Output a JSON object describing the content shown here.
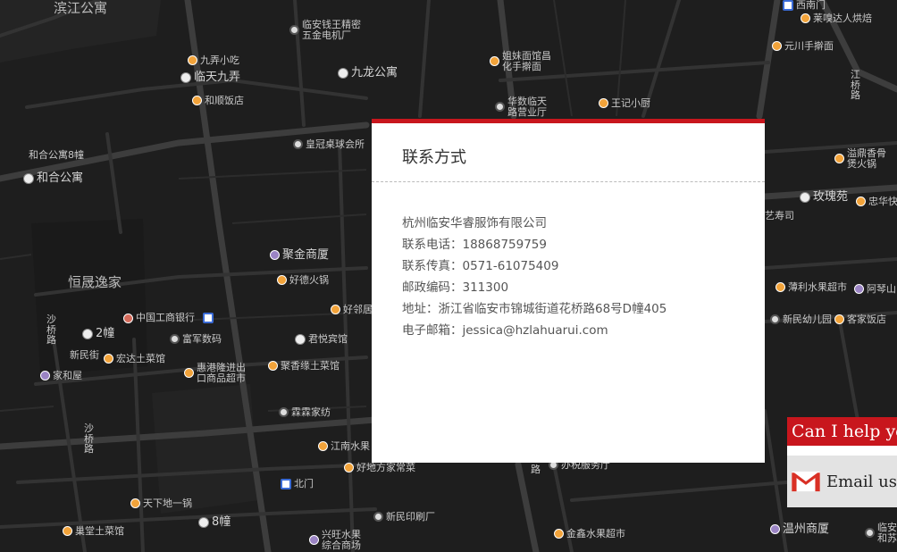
{
  "map": {
    "pois": [
      {
        "label": "滨江公寓",
        "kind": "district"
      },
      {
        "label": "临安钱王精密",
        "kind": "dot"
      },
      {
        "label": "五金电机厂",
        "kind": "none"
      },
      {
        "label": "九弄小吃",
        "kind": "food"
      },
      {
        "label": "临天九弄",
        "kind": "bld"
      },
      {
        "label": "和顺饭店",
        "kind": "food"
      },
      {
        "label": "九龙公寓",
        "kind": "bld"
      },
      {
        "label": "姐妹面馆昌",
        "kind": "food"
      },
      {
        "label": "化手擀面",
        "kind": "none"
      },
      {
        "label": "华数临天",
        "kind": "dot"
      },
      {
        "label": "路营业厅",
        "kind": "none"
      },
      {
        "label": "王记小厨",
        "kind": "food"
      },
      {
        "label": "莱嗅达人烘焙",
        "kind": "food"
      },
      {
        "label": "元川手擀面",
        "kind": "food"
      },
      {
        "label": "江",
        "kind": "none"
      },
      {
        "label": "桥",
        "kind": "none"
      },
      {
        "label": "路",
        "kind": "none"
      },
      {
        "label": "和合公寓8幢",
        "kind": "none"
      },
      {
        "label": "和合公寓",
        "kind": "bld"
      },
      {
        "label": "皇冠桌球会所",
        "kind": "dot"
      },
      {
        "label": "溢鼎香骨",
        "kind": "food"
      },
      {
        "label": "煲火锅",
        "kind": "none"
      },
      {
        "label": "玫瑰苑",
        "kind": "bld"
      },
      {
        "label": "忠华快",
        "kind": "food"
      },
      {
        "label": "艺寿司",
        "kind": "none"
      },
      {
        "label": "恒晟逸家",
        "kind": "district"
      },
      {
        "label": "聚金商厦",
        "kind": "shop"
      },
      {
        "label": "好德火锅",
        "kind": "food"
      },
      {
        "label": "好邻居",
        "kind": "food"
      },
      {
        "label": "中国工商银行",
        "kind": "bank"
      },
      {
        "label": "2幢",
        "kind": "bld"
      },
      {
        "label": "富军数码",
        "kind": "dot"
      },
      {
        "label": "君悦宾馆",
        "kind": "bld"
      },
      {
        "label": "新民街",
        "kind": "none"
      },
      {
        "label": "宏达土菜馆",
        "kind": "food"
      },
      {
        "label": "家和屋",
        "kind": "shop"
      },
      {
        "label": "惠港隆进出",
        "kind": "food"
      },
      {
        "label": "口商品超市",
        "kind": "none"
      },
      {
        "label": "聚香缘土菜馆",
        "kind": "food"
      },
      {
        "label": "霖霖家纺",
        "kind": "dot"
      },
      {
        "label": "江南水果",
        "kind": "food"
      },
      {
        "label": "好地方家常菜",
        "kind": "food"
      },
      {
        "label": "北门",
        "kind": "bus"
      },
      {
        "label": "天下地一锅",
        "kind": "food"
      },
      {
        "label": "8幢",
        "kind": "bld"
      },
      {
        "label": "巢堂土菜馆",
        "kind": "food"
      },
      {
        "label": "新民印刷厂",
        "kind": "dot"
      },
      {
        "label": "兴旺水果",
        "kind": "shop"
      },
      {
        "label": "综合商场",
        "kind": "none"
      },
      {
        "label": "金鑫水果超市",
        "kind": "food"
      },
      {
        "label": "办税服务厅",
        "kind": "dot"
      },
      {
        "label": "薄利水果超市",
        "kind": "food"
      },
      {
        "label": "阿琴山",
        "kind": "shop"
      },
      {
        "label": "新民幼儿园",
        "kind": "dot"
      },
      {
        "label": "客家饭店",
        "kind": "food"
      },
      {
        "label": "温州商厦",
        "kind": "shop"
      },
      {
        "label": "临安",
        "kind": "dot"
      },
      {
        "label": "和苏",
        "kind": "none"
      },
      {
        "label": "西南门",
        "kind": "bus"
      },
      {
        "label": "沙",
        "kind": "none"
      },
      {
        "label": "桥",
        "kind": "none"
      },
      {
        "label": "路",
        "kind": "none"
      },
      {
        "label": "沙",
        "kind": "none"
      },
      {
        "label": "桥",
        "kind": "none"
      },
      {
        "label": "路",
        "kind": "none"
      },
      {
        "label": "路",
        "kind": "none"
      }
    ]
  },
  "contact": {
    "title": "联系方式",
    "company": "杭州临安华睿服饰有限公司",
    "phone": "联系电话：18868759759",
    "fax": "联系传真：0571-61075409",
    "postcode": "邮政编码：311300",
    "address": "地址：浙江省临安市锦城街道花桥路68号D幢405",
    "email": "电子邮箱：jessica@hzlahuarui.com"
  },
  "help_widget": {
    "header": "Can I help you",
    "email_label": "Email us",
    "icon": "gmail-envelope-icon"
  },
  "colors": {
    "accent": "#c8161d",
    "map_bg": "#1e1e1e",
    "road": "#3b3b3b"
  }
}
